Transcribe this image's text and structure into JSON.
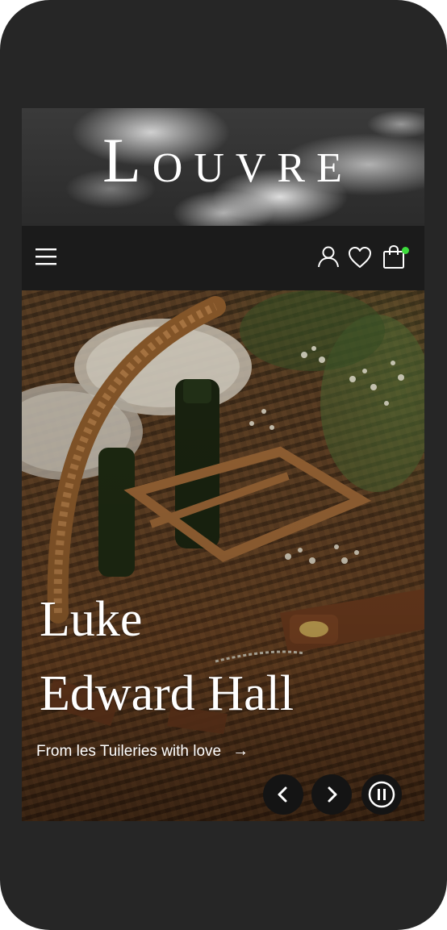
{
  "brand": {
    "logo_first": "L",
    "logo_rest": "OUVRE"
  },
  "navbar": {
    "icons": [
      "menu-icon",
      "account-icon",
      "heart-icon",
      "shopping-bag-icon"
    ],
    "cart_indicator_color": "#3ddc3d"
  },
  "hero": {
    "title_line1": "Luke",
    "title_line2": "Edward Hall",
    "link_text": "From les Tuileries with love",
    "link_arrow": "→",
    "controls": [
      "chevron-left-icon",
      "chevron-right-icon",
      "pause-icon"
    ]
  },
  "colors": {
    "device_frame": "#262626",
    "navbar_bg": "#1b1b1b",
    "text": "#ffffff",
    "control_bg": "#141414"
  }
}
